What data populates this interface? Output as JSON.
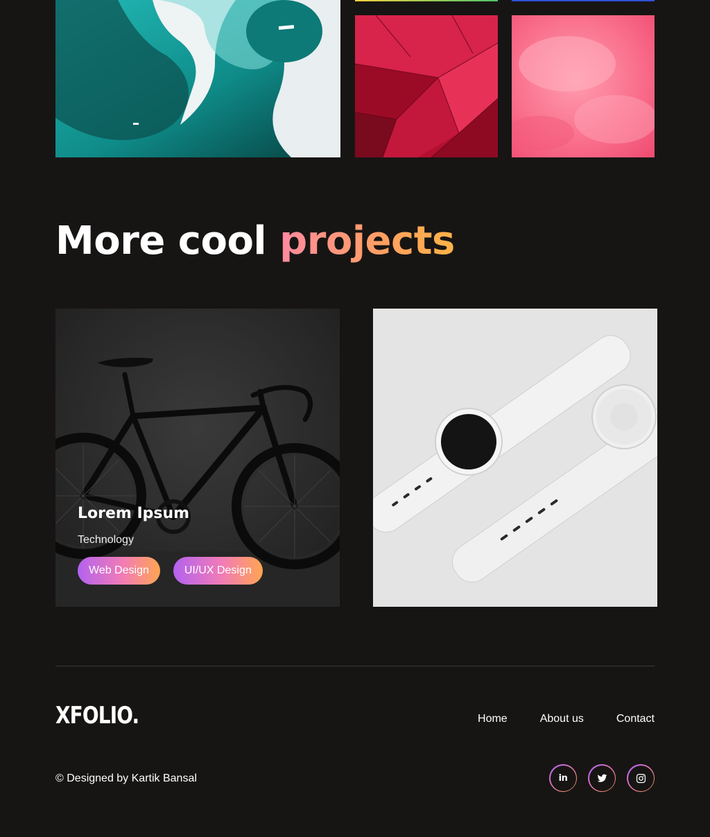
{
  "gallery": {
    "images": [
      {
        "name": "ice-water-aerial-image",
        "colors": [
          "#0f6b6a",
          "#1fb3b0",
          "#e8eeef"
        ]
      },
      {
        "name": "red-geometric-facade-image",
        "colors": [
          "#8c0a22",
          "#d81f48",
          "#ff4f6e"
        ]
      },
      {
        "name": "pink-clouds-image",
        "colors": [
          "#f4587a",
          "#ff8aa0",
          "#ffb0c0"
        ]
      }
    ]
  },
  "section": {
    "title_part1": "More cool",
    "title_part2": "projects",
    "accent_gradient": [
      "#ff8aa0",
      "#ffa060",
      "#ffb347"
    ]
  },
  "projects": [
    {
      "image": "black-road-bike-image",
      "title": "Lorem Ipsum",
      "category": "Technology",
      "tags": [
        "Web Design",
        "UI/UX Design"
      ]
    },
    {
      "image": "white-smartwatches-image"
    }
  ],
  "footer": {
    "logo": "XFOLIO.",
    "nav": [
      "Home",
      "About us",
      "Contact"
    ],
    "copyright": "© Designed by Kartik Bansal",
    "socials": [
      {
        "name": "linkedin-icon",
        "label": "in"
      },
      {
        "name": "twitter-icon"
      },
      {
        "name": "instagram-icon"
      }
    ],
    "pill_gradient": [
      "#b362f0",
      "#f27cb5",
      "#ffa552"
    ]
  }
}
